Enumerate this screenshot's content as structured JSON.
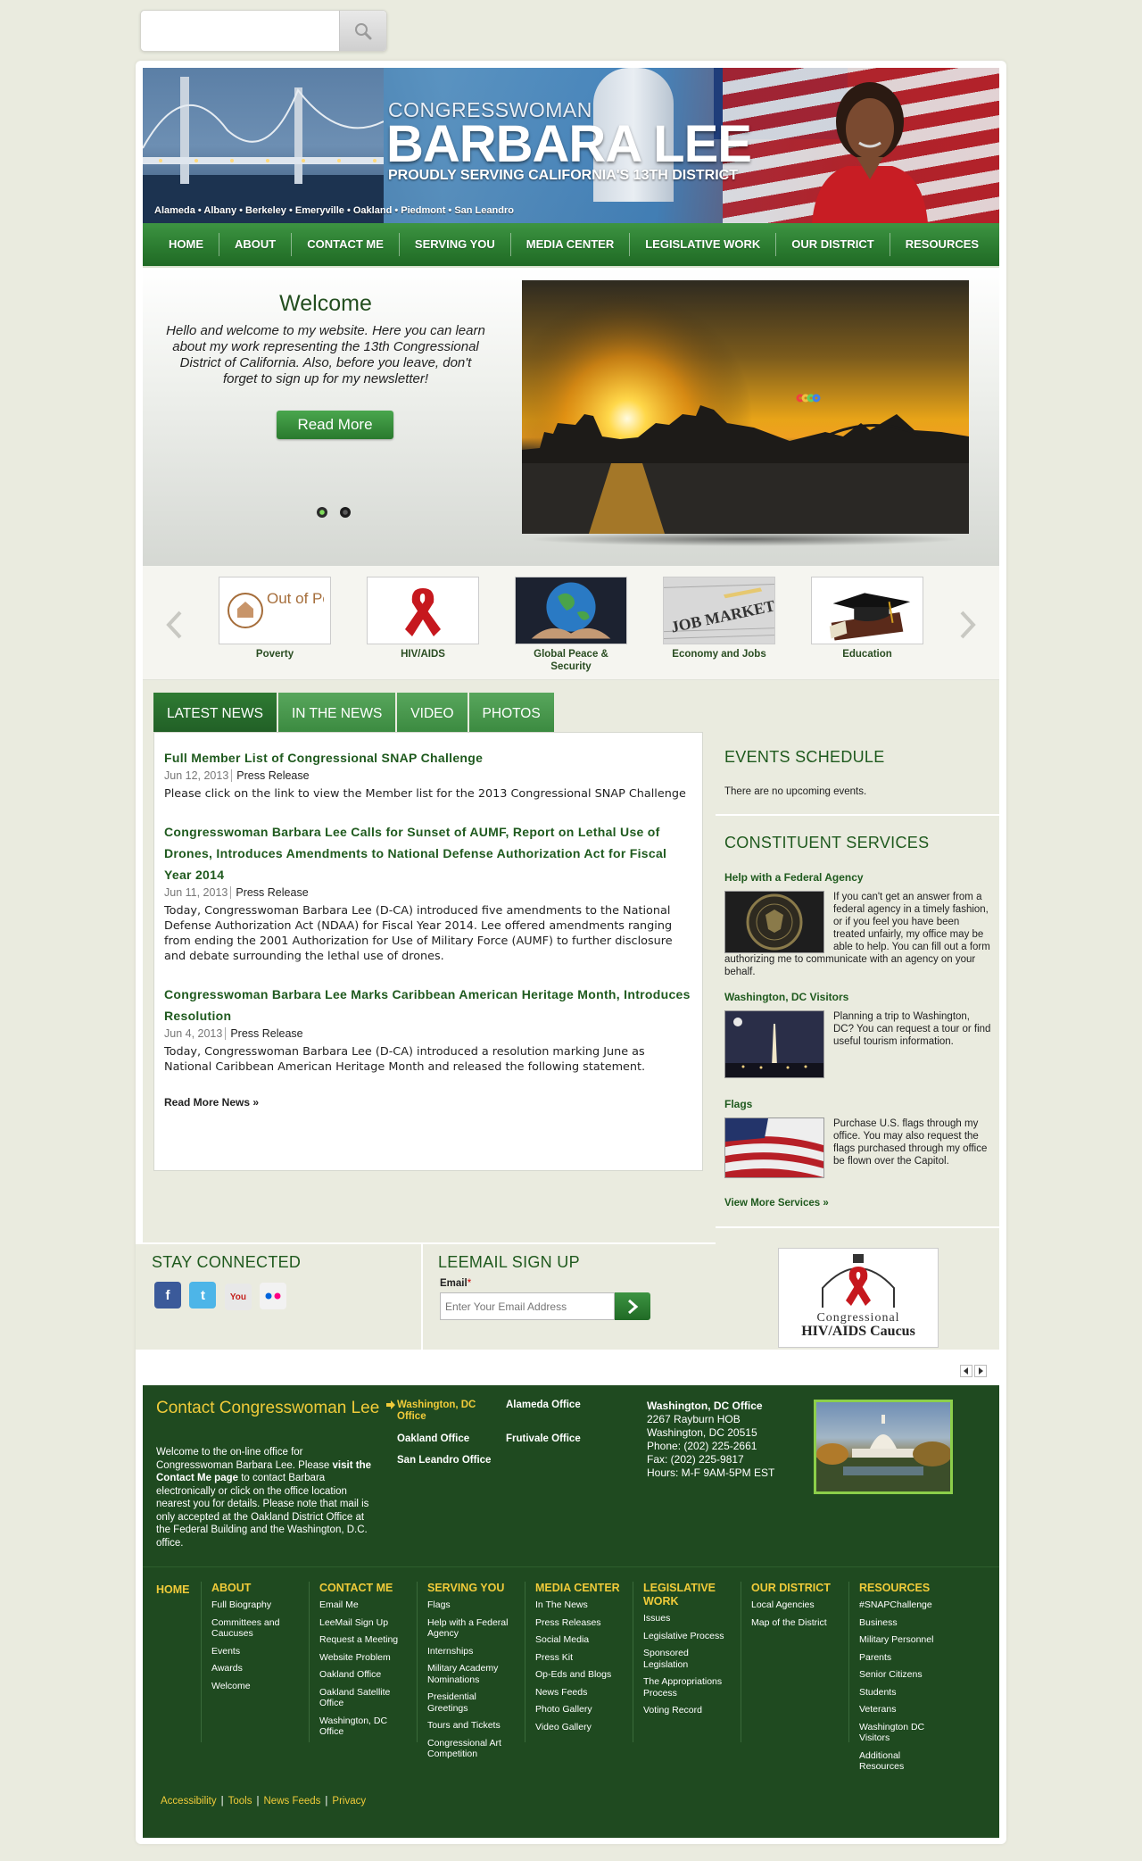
{
  "search": {
    "placeholder": ""
  },
  "banner": {
    "line1": "CONGRESSWOMAN",
    "line2": "BARBARA LEE",
    "line3": "PROUDLY SERVING CALIFORNIA'S 13TH DISTRICT",
    "cities": "Alameda • Albany • Berkeley • Emeryville • Oakland • Piedmont • San Leandro"
  },
  "nav": [
    "HOME",
    "ABOUT",
    "CONTACT ME",
    "SERVING YOU",
    "MEDIA CENTER",
    "LEGISLATIVE WORK",
    "OUR DISTRICT",
    "RESOURCES"
  ],
  "welcome": {
    "title": "Welcome",
    "body": "Hello and welcome to my website. Here you can learn about my work representing the 13th Congressional District of California. Also, before you leave, don't forget to sign up for my newsletter!",
    "button": "Read More"
  },
  "issues": [
    {
      "label": "Poverty",
      "logo_text": "Out of Poverty Caucus"
    },
    {
      "label": "HIV/AIDS"
    },
    {
      "label": "Global Peace & Security"
    },
    {
      "label": "Economy and Jobs"
    },
    {
      "label": "Education"
    }
  ],
  "news": {
    "tabs": [
      "LATEST NEWS",
      "IN THE NEWS",
      "VIDEO",
      "PHOTOS"
    ],
    "items": [
      {
        "title": "Full Member List of Congressional SNAP Challenge",
        "date": "Jun 12, 2013",
        "type": "Press Release",
        "desc": "Please click on the link to view the Member list for the 2013 Congressional SNAP Challenge"
      },
      {
        "title": "Congresswoman Barbara Lee Calls for Sunset of AUMF, Report on Lethal Use of Drones, Introduces Amendments to National Defense Authorization Act for Fiscal Year 2014",
        "date": "Jun 11, 2013",
        "type": "Press Release",
        "desc": "Today, Congresswoman Barbara Lee (D-CA) introduced five amendments to the National Defense Authorization Act (NDAA) for Fiscal Year 2014. Lee offered amendments ranging from ending the 2001 Authorization for Use of Military Force (AUMF) to further disclosure and debate surrounding the lethal use of drones."
      },
      {
        "title": "Congresswoman Barbara Lee Marks Caribbean American Heritage Month, Introduces Resolution",
        "date": "Jun 4, 2013",
        "type": "Press Release",
        "desc": "Today, Congresswoman Barbara Lee (D-CA) introduced a resolution marking June as National Caribbean American Heritage Month and released the following statement."
      }
    ],
    "read_more": "Read More News »"
  },
  "events": {
    "title": "EVENTS SCHEDULE",
    "text": "There are no upcoming events."
  },
  "services": {
    "title": "CONSTITUENT SERVICES",
    "items": [
      {
        "title": "Help with a Federal Agency",
        "text": "If you can't get an answer from a federal agency in a timely fashion, or if you feel you have been treated unfairly, my office may be able to help. You can fill out a form authorizing me to communicate with an agency on your behalf."
      },
      {
        "title": "Washington, DC Visitors",
        "text": "Planning a trip to Washington, DC? You can request a tour or find useful tourism information."
      },
      {
        "title": "Flags",
        "text": "Purchase U.S. flags through my office. You may also request the flags purchased through my office be flown over the Capitol."
      }
    ],
    "more": "View More Services »"
  },
  "stay": {
    "title": "STAY CONNECTED"
  },
  "leemail": {
    "title": "LEEMAIL SIGN UP",
    "email_label": "Email",
    "required": "*",
    "placeholder": "Enter Your Email Address"
  },
  "caucus": {
    "line1": "Congressional",
    "line2": "HIV/AIDS Caucus"
  },
  "contact": {
    "title": "Contact Congresswoman Lee",
    "body_a": "Welcome to the on-line office for Congresswoman Barbara Lee. Please ",
    "body_link": "visit the Contact Me page",
    "body_b": " to contact Barbara electronically or click on the office location nearest you for details. Please note that mail is only accepted at the Oakland District Office at the Federal Building and the Washington, D.C. office.",
    "offices": [
      "Washington, DC Office",
      "Alameda Office",
      "Oakland Office",
      "Frutivale Office",
      "San Leandro Office"
    ],
    "addr": {
      "name": "Washington, DC Office",
      "line1": "2267 Rayburn HOB",
      "line2": "Washington, DC 20515",
      "phone": "Phone: (202) 225-2661",
      "fax": "Fax: (202) 225-9817",
      "hours": "Hours: M-F 9AM-5PM EST"
    }
  },
  "footer": {
    "columns": [
      {
        "head": "HOME",
        "links": []
      },
      {
        "head": "ABOUT",
        "links": [
          "Full Biography",
          "Committees and Caucuses",
          "Events",
          "Awards",
          "Welcome"
        ]
      },
      {
        "head": "CONTACT ME",
        "links": [
          "Email Me",
          "LeeMail Sign Up",
          "Request a Meeting",
          "Website Problem",
          "Oakland Office",
          "Oakland Satellite Office",
          "Washington, DC Office"
        ]
      },
      {
        "head": "SERVING YOU",
        "links": [
          "Flags",
          "Help with a Federal Agency",
          "Internships",
          "Military Academy Nominations",
          "Presidential Greetings",
          "Tours and Tickets",
          "Congressional Art Competition"
        ]
      },
      {
        "head": "MEDIA CENTER",
        "links": [
          "In The News",
          "Press Releases",
          "Social Media",
          "Press Kit",
          "Op-Eds and Blogs",
          "News Feeds",
          "Photo Gallery",
          "Video Gallery"
        ]
      },
      {
        "head": "LEGISLATIVE WORK",
        "links": [
          "Issues",
          "Legislative Process",
          "Sponsored Legislation",
          "The Appropriations Process",
          "Voting Record"
        ]
      },
      {
        "head": "OUR DISTRICT",
        "links": [
          "Local Agencies",
          "Map of the District"
        ]
      },
      {
        "head": "RESOURCES",
        "links": [
          "#SNAPChallenge",
          "Business",
          "Military Personnel",
          "Parents",
          "Senior Citizens",
          "Students",
          "Veterans",
          "Washington DC Visitors",
          "Additional Resources"
        ]
      }
    ],
    "bottom": [
      "Accessibility",
      "Tools",
      "News Feeds",
      "Privacy"
    ]
  },
  "colors": {
    "green": "#2a7a2f",
    "dark_green": "#1f4a20",
    "gold": "#f0cb3a",
    "bg": "#eaebdf"
  }
}
